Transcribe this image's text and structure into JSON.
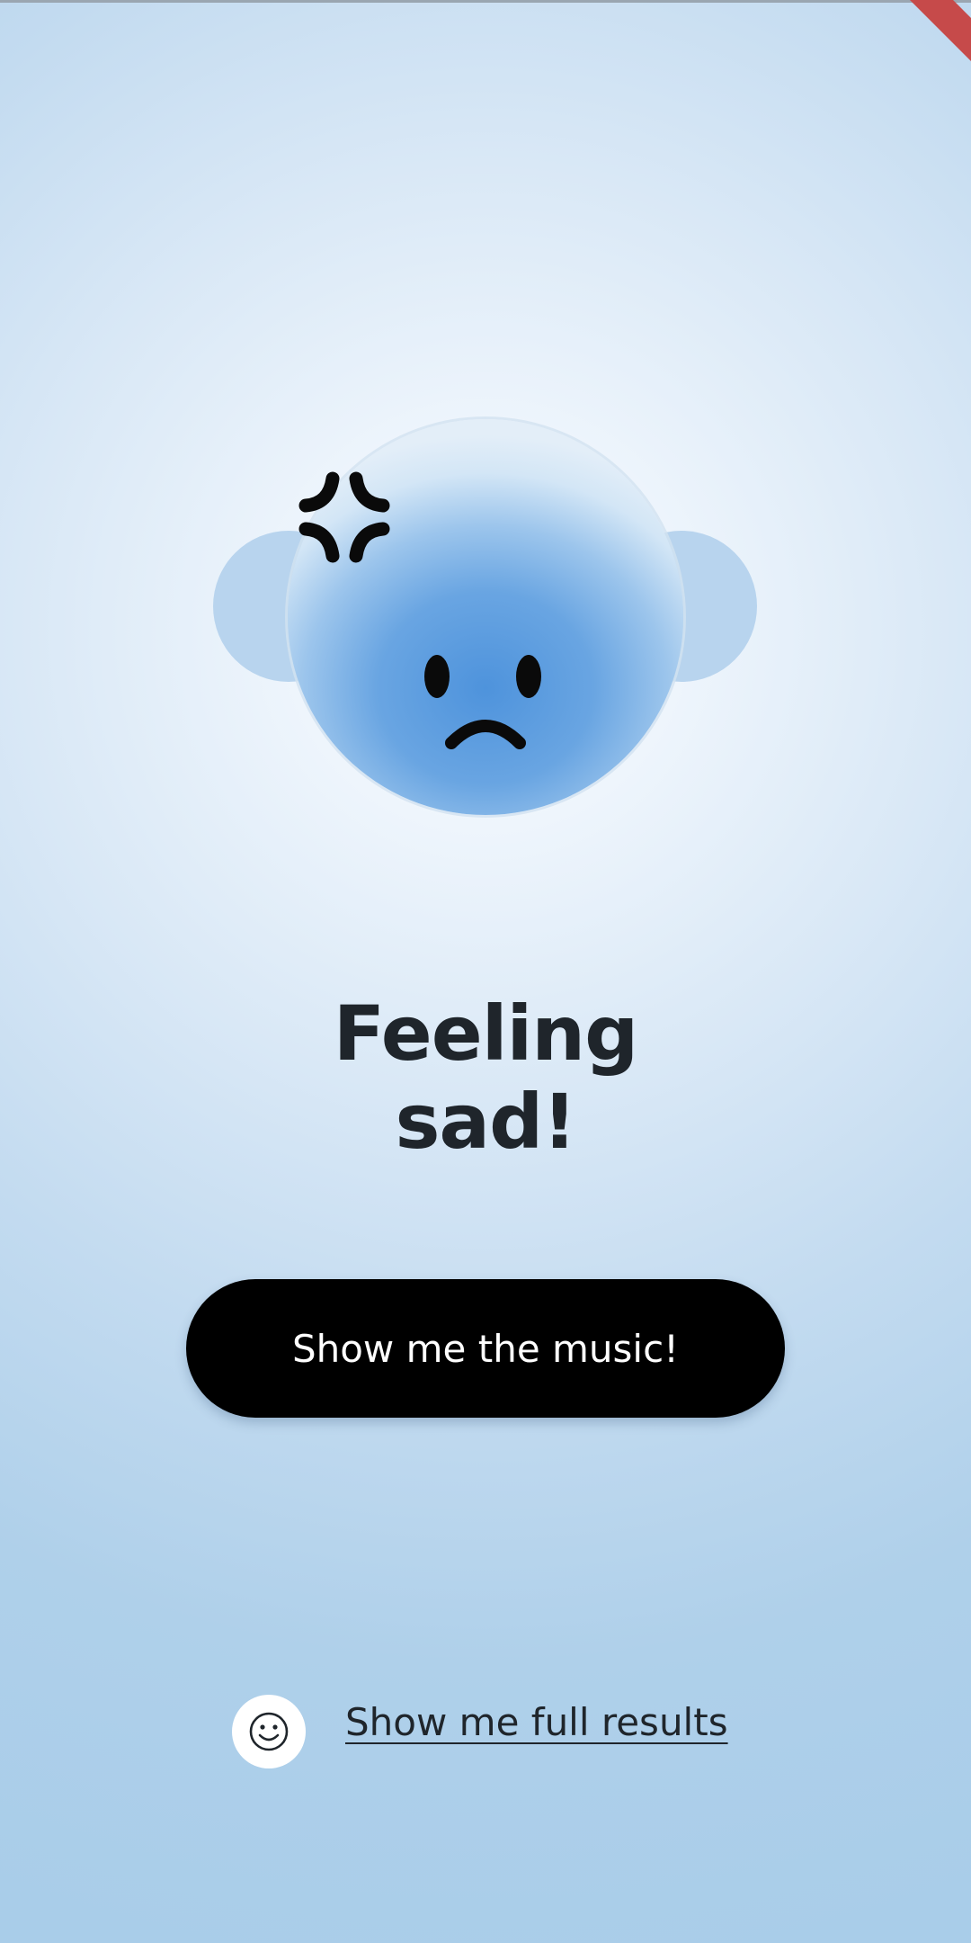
{
  "mood": {
    "headline_line1": "Feeling",
    "headline_line2": "sad!",
    "face_expression": "sad",
    "face_accessory_icon": "anger-symbol-icon"
  },
  "actions": {
    "music_button_label": "Show me the music!",
    "full_results_label": "Show me full results",
    "full_results_icon": "smiley-icon"
  },
  "colors": {
    "background": "#a9cde9",
    "face_blue": "#4e93dc",
    "button_bg": "#000000",
    "button_text": "#ffffff",
    "text": "#1f252b"
  }
}
